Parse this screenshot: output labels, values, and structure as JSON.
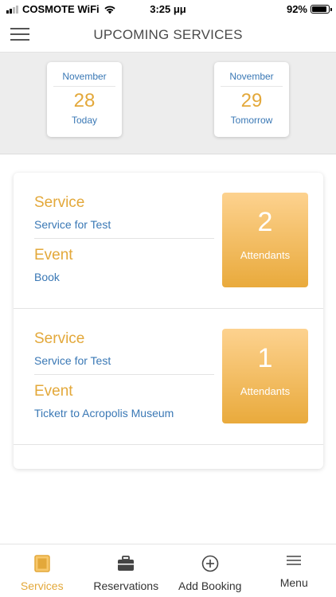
{
  "status_bar": {
    "carrier": "COSMOTE WiFi",
    "time": "3:25 μμ",
    "battery": "92%",
    "battery_level": 0.92
  },
  "header": {
    "title": "UPCOMING SERVICES",
    "menu_icon": "hamburger-icon"
  },
  "dates": [
    {
      "month": "November",
      "day": "28",
      "label": "Today"
    },
    {
      "month": "November",
      "day": "29",
      "label": "Tomorrow"
    }
  ],
  "services": [
    {
      "service_label": "Service",
      "service_value": "Service for Test",
      "event_label": "Event",
      "event_value": "Book",
      "attendants_count": "2",
      "attendants_label": "Attendants"
    },
    {
      "service_label": "Service",
      "service_value": "Service for Test",
      "event_label": "Event",
      "event_value": "Ticketr to Acropolis Museum",
      "attendants_count": "1",
      "attendants_label": "Attendants"
    }
  ],
  "tabs": [
    {
      "label": "Services",
      "icon": "services-icon",
      "active": true
    },
    {
      "label": "Reservations",
      "icon": "briefcase-icon",
      "active": false
    },
    {
      "label": "Add Booking",
      "icon": "plus-circle-icon",
      "active": false
    },
    {
      "label": "Menu",
      "icon": "menu-lines-icon",
      "active": false
    }
  ],
  "colors": {
    "accent_orange": "#e3a83a",
    "link_blue": "#3a78b5",
    "attend_gradient_top": "#fdd28f",
    "attend_gradient_bottom": "#e9aa3c"
  }
}
